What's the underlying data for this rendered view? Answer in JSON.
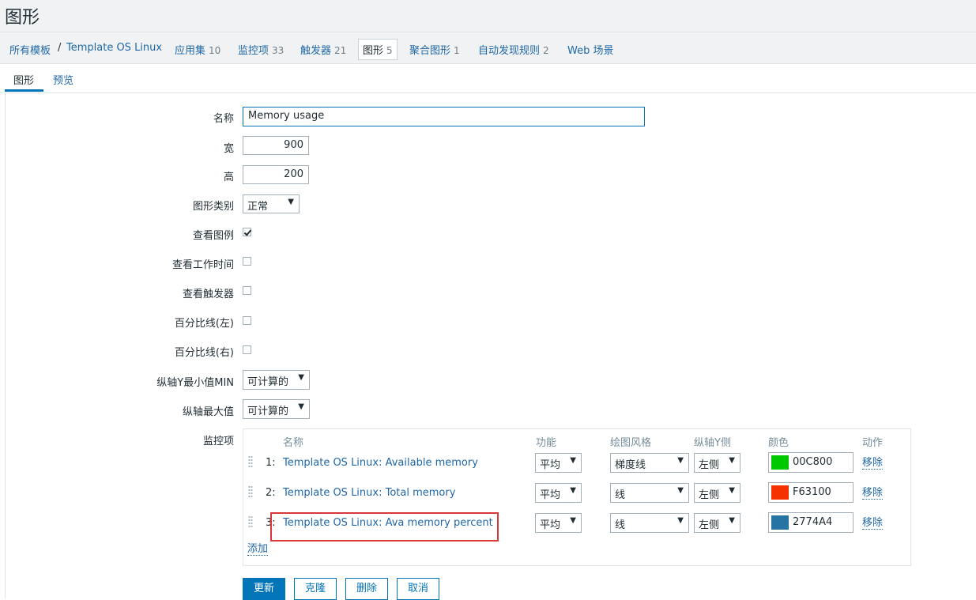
{
  "page_title": "图形",
  "breadcrumb": {
    "all_templates": "所有模板",
    "separator": "/",
    "template": "Template OS Linux",
    "items": [
      {
        "label": "应用集",
        "count": "10"
      },
      {
        "label": "监控项",
        "count": "33"
      },
      {
        "label": "触发器",
        "count": "21"
      },
      {
        "label": "图形",
        "count": "5"
      },
      {
        "label": "聚合图形",
        "count": "1"
      },
      {
        "label": "自动发现规则",
        "count": "2"
      },
      {
        "label": "Web 场景",
        "count": ""
      }
    ]
  },
  "subtabs": [
    "图形",
    "预览"
  ],
  "form": {
    "name_label": "名称",
    "name_value": "Memory usage",
    "width_label": "宽",
    "width_value": "900",
    "height_label": "高",
    "height_value": "200",
    "graph_type_label": "图形类别",
    "graph_type_value": "正常",
    "show_legend_label": "查看图例",
    "show_legend_checked": true,
    "show_working_time_label": "查看工作时间",
    "show_triggers_label": "查看触发器",
    "percentile_left_label": "百分比线(左)",
    "percentile_right_label": "百分比线(右)",
    "ymin_label": "纵轴Y最小值MIN",
    "ymin_value": "可计算的",
    "ymax_label": "纵轴最大值",
    "ymax_value": "可计算的",
    "items_label": "监控项"
  },
  "items_table": {
    "headers": [
      "名称",
      "功能",
      "绘图风格",
      "纵轴Y侧",
      "颜色",
      "动作"
    ],
    "rows": [
      {
        "num": "1:",
        "name": "Template OS Linux: Available memory",
        "function": "平均",
        "style": "梯度线",
        "side": "左侧",
        "color": "00C800",
        "color_hex": "#00C800",
        "action": "移除"
      },
      {
        "num": "2:",
        "name": "Template OS Linux: Total memory",
        "function": "平均",
        "style": "线",
        "side": "左侧",
        "color": "F63100",
        "color_hex": "#F63100",
        "action": "移除"
      },
      {
        "num": "3:",
        "name": "Template OS Linux: Ava memory percent",
        "function": "平均",
        "style": "线",
        "side": "左侧",
        "color": "2774A4",
        "color_hex": "#2774A4",
        "action": "移除"
      }
    ],
    "add_label": "添加"
  },
  "buttons": {
    "update": "更新",
    "clone": "克隆",
    "delete": "删除",
    "cancel": "取消"
  },
  "colors": {
    "accent": "#0275b8",
    "link": "#1f67a6",
    "highlight": "#d9383a"
  }
}
